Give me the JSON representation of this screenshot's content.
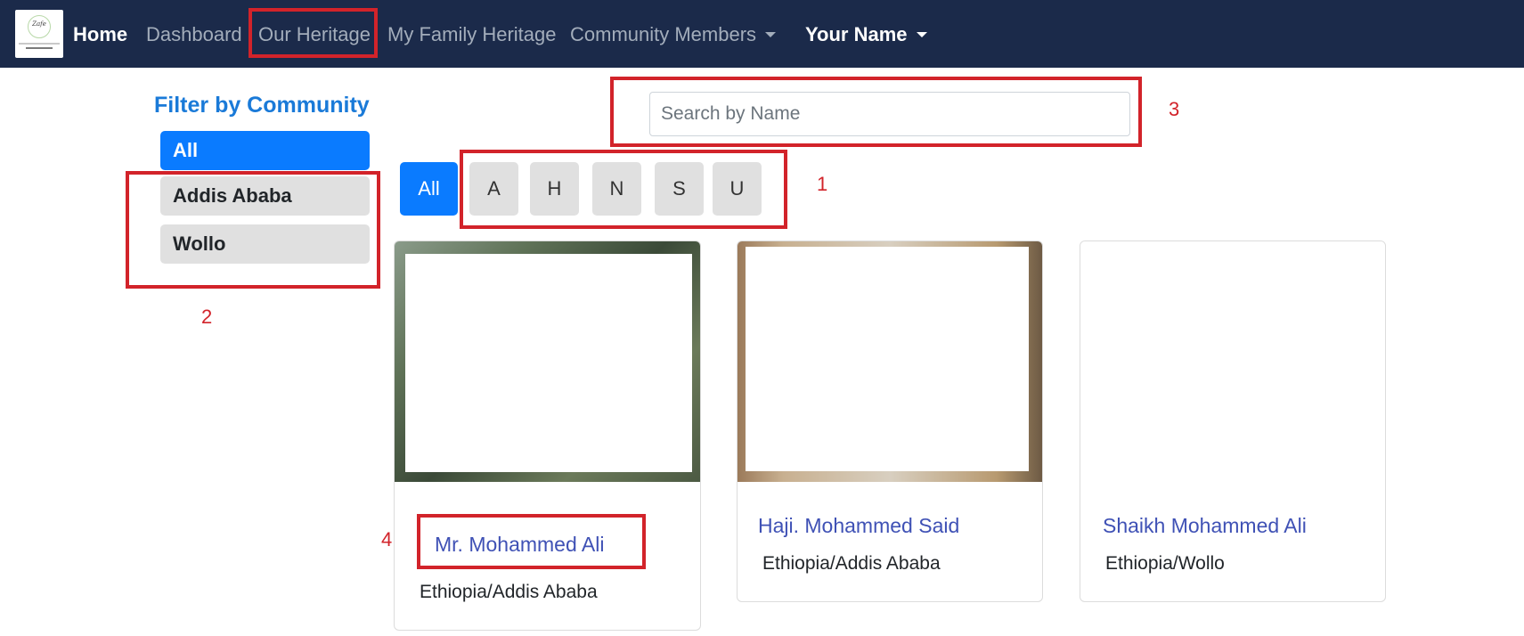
{
  "navbar": {
    "logo_text": "Zafe",
    "items": [
      {
        "label": "Home"
      },
      {
        "label": "Dashboard"
      },
      {
        "label": "Our Heritage"
      },
      {
        "label": "My Family Heritage"
      },
      {
        "label": "Community Members"
      },
      {
        "label": "Your Name"
      }
    ]
  },
  "sidebar": {
    "title": "Filter by Community",
    "items": [
      {
        "label": "All"
      },
      {
        "label": "Addis Ababa"
      },
      {
        "label": "Wollo"
      }
    ]
  },
  "search": {
    "placeholder": "Search by Name",
    "value": ""
  },
  "letters": [
    "All",
    "A",
    "H",
    "N",
    "S",
    "U"
  ],
  "cards": [
    {
      "name": "Mr. Mohammed Ali",
      "location": "Ethiopia/Addis Ababa"
    },
    {
      "name": "Haji. Mohammed Said",
      "location": "Ethiopia/Addis Ababa"
    },
    {
      "name": "Shaikh Mohammed Ali",
      "location": "Ethiopia/Wollo"
    }
  ],
  "annotations": [
    "1",
    "2",
    "3",
    "4"
  ],
  "colors": {
    "navbar_bg": "#1b2a4a",
    "primary": "#0a7bff",
    "annotation_red": "#d2232a",
    "link_indigo": "#3f51b5"
  }
}
